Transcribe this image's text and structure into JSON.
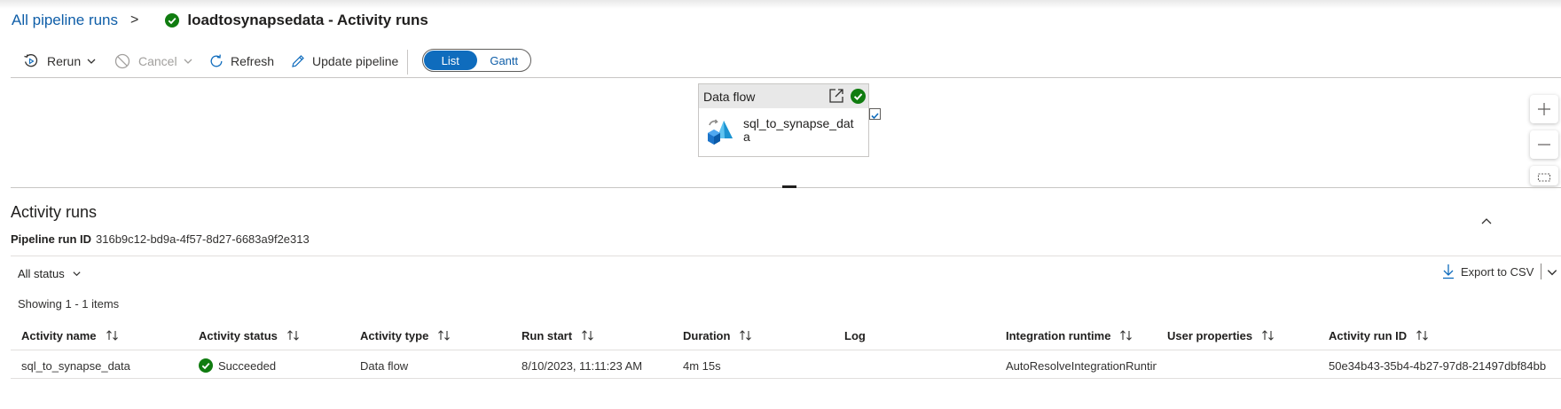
{
  "breadcrumb": {
    "parent_link": "All pipeline runs",
    "separator": ">",
    "title": "loadtosynapsedata - Activity runs",
    "status_icon": "success-check-icon"
  },
  "toolbar": {
    "rerun_label": "Rerun",
    "cancel_label": "Cancel",
    "refresh_label": "Refresh",
    "update_label": "Update pipeline",
    "view_toggle": {
      "options": [
        "List",
        "Gantt"
      ],
      "selected": "List"
    }
  },
  "canvas": {
    "activity_card": {
      "type_label": "Data flow",
      "name": "sql_to_synapse_data",
      "status_icon": "success-check-icon"
    },
    "zoom_controls": [
      "zoom-in-icon",
      "zoom-out-icon",
      "fit-to-screen-icon"
    ]
  },
  "panel": {
    "title": "Activity runs",
    "pipeline_run_id_label": "Pipeline run ID",
    "pipeline_run_id": "316b9c12-bd9a-4f57-8d27-6683a9f2e313",
    "status_filter": "All status",
    "export_label": "Export to CSV",
    "showing": "Showing 1 - 1 items"
  },
  "table": {
    "columns": [
      "Activity name",
      "Activity status",
      "Activity type",
      "Run start",
      "Duration",
      "Log",
      "Integration runtime",
      "User properties",
      "Activity run ID"
    ],
    "rows": [
      {
        "activity_name": "sql_to_synapse_data",
        "activity_status": "Succeeded",
        "activity_type": "Data flow",
        "run_start": "8/10/2023, 11:11:23 AM",
        "duration": "4m 15s",
        "log": "",
        "integration_runtime": "AutoResolveIntegrationRuntime",
        "user_properties": "",
        "activity_run_id": "50e34b43-35b4-4b27-97d8-21497dbf84bb"
      }
    ]
  },
  "colors": {
    "brand_blue": "#0f6cbd",
    "link_blue": "#0f5ea8",
    "success_green": "#107c10"
  }
}
